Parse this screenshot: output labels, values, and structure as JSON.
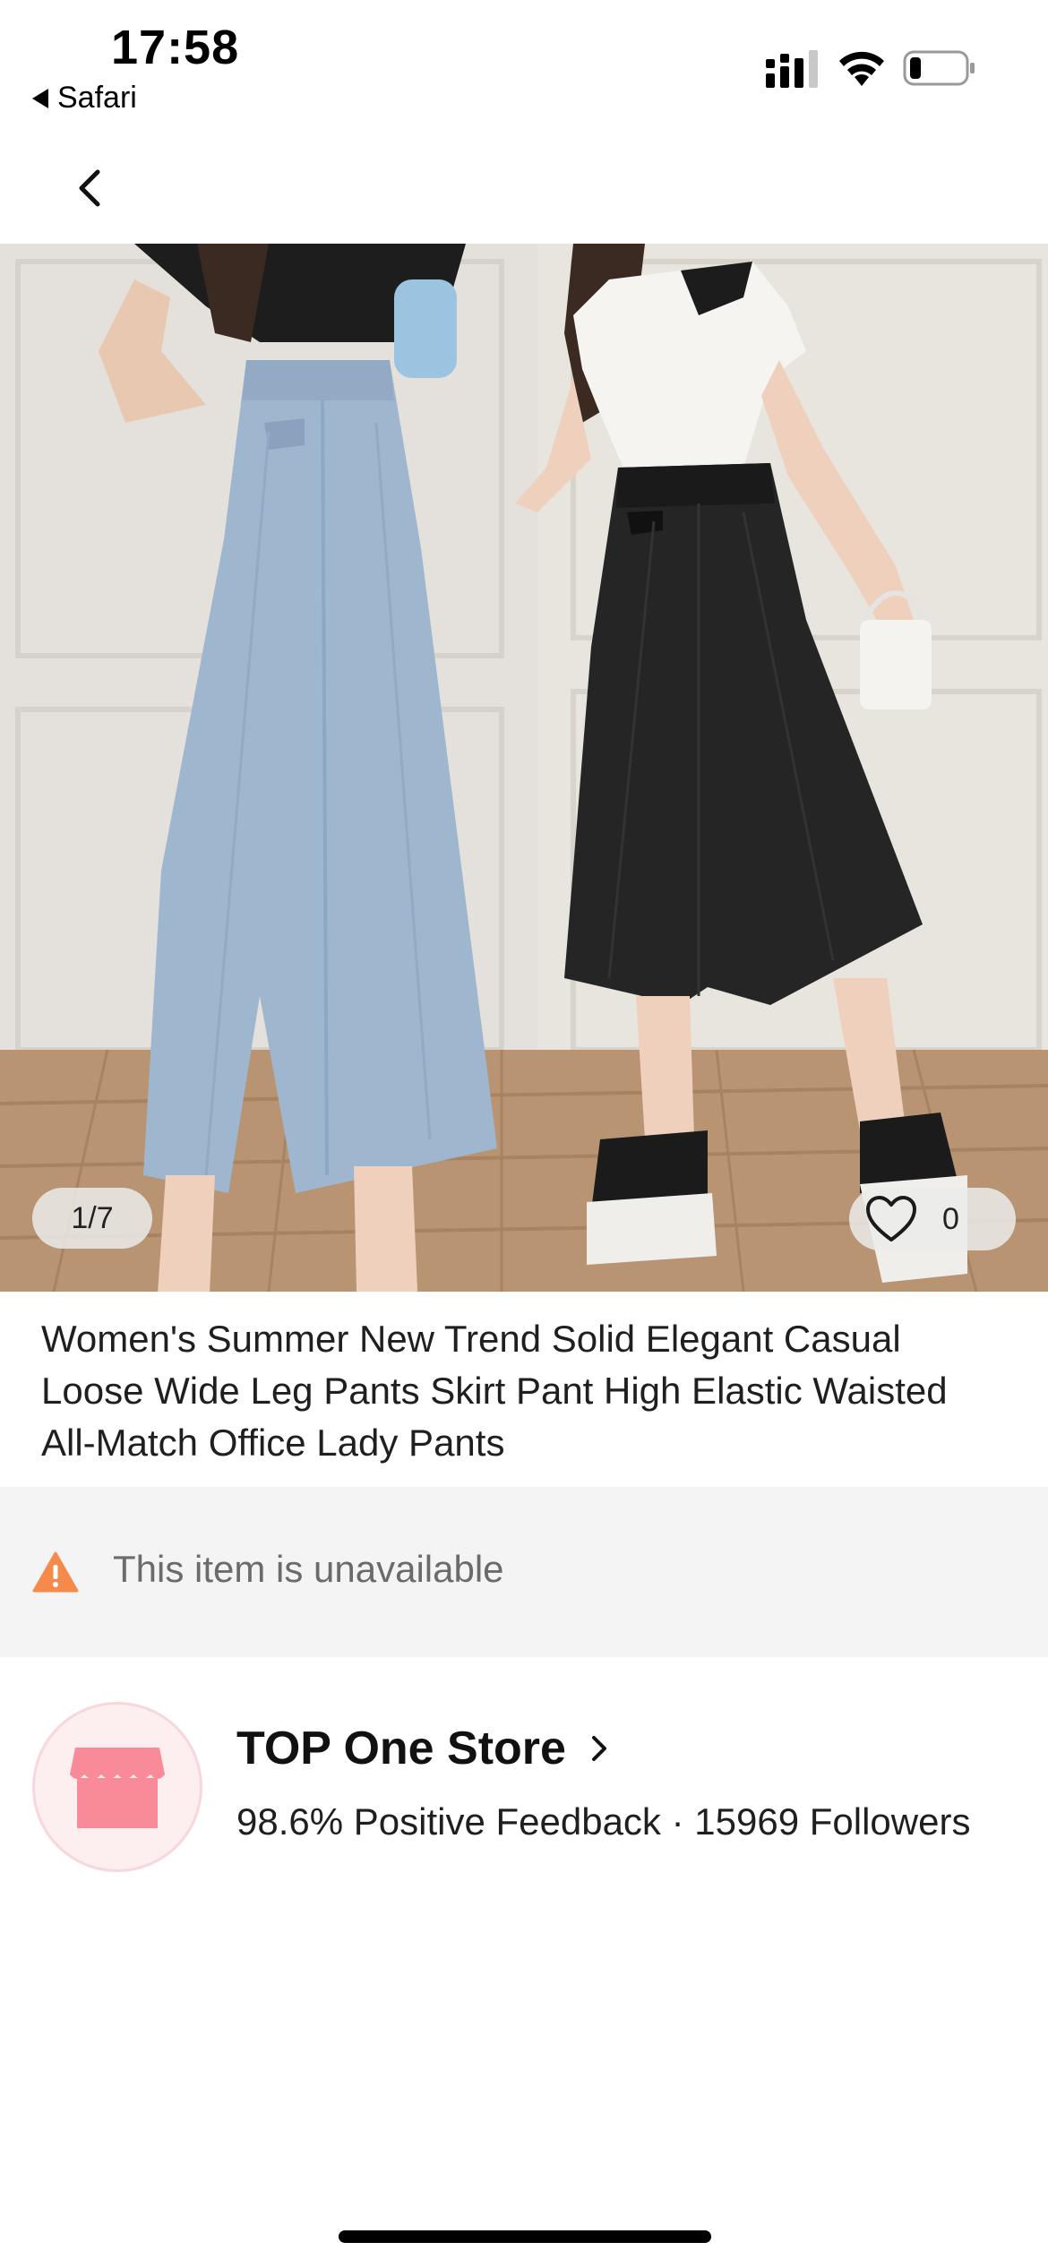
{
  "status_bar": {
    "time": "17:58",
    "back_app": "Safari"
  },
  "product": {
    "image_counter": "1/7",
    "wishlist_count": "0",
    "title": "Women's Summer New Trend Solid Elegant Casual Loose Wide Leg Pants Skirt Pant High Elastic Waisted All-Match Office Lady Pants"
  },
  "notice": {
    "text": "This item is unavailable",
    "color": "#f58a4b"
  },
  "store": {
    "name": "TOP One Store",
    "feedback": "98.6% Positive Feedback",
    "separator": "·",
    "followers": "15969 Followers",
    "avatar_color": "#f98a97"
  },
  "icons": {
    "nav_back": "chevron-left-icon",
    "wishlist": "heart-icon",
    "warning": "warning-icon",
    "store_arrow": "chevron-right-icon",
    "store_avatar": "storefront-icon"
  }
}
